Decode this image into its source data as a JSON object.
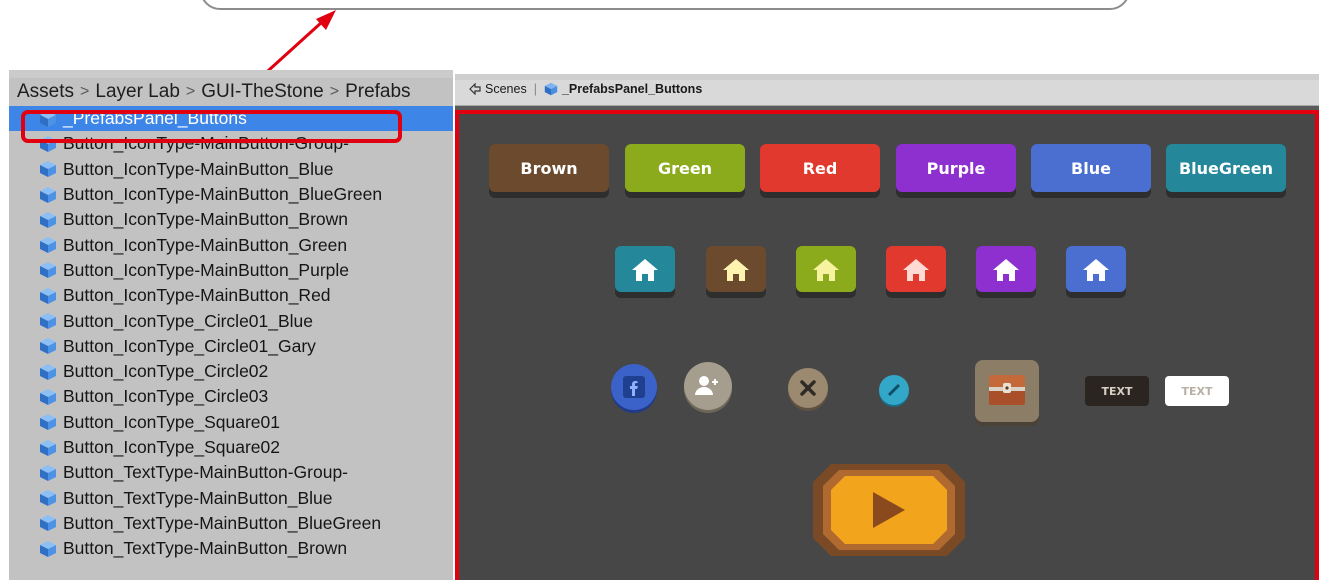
{
  "project_panel": {
    "breadcrumb": [
      "Assets",
      "Layer Lab",
      "GUI-TheStone",
      "Prefabs"
    ],
    "items": [
      {
        "label": "_PrefabsPanel_Buttons",
        "selected": true
      },
      {
        "label": "Button_IconType-MainButton-Group-"
      },
      {
        "label": "Button_IconType-MainButton_Blue"
      },
      {
        "label": "Button_IconType-MainButton_BlueGreen"
      },
      {
        "label": "Button_IconType-MainButton_Brown"
      },
      {
        "label": "Button_IconType-MainButton_Green"
      },
      {
        "label": "Button_IconType-MainButton_Purple"
      },
      {
        "label": "Button_IconType-MainButton_Red"
      },
      {
        "label": "Button_IconType_Circle01_Blue"
      },
      {
        "label": "Button_IconType_Circle01_Gary"
      },
      {
        "label": "Button_IconType_Circle02"
      },
      {
        "label": "Button_IconType_Circle03"
      },
      {
        "label": "Button_IconType_Square01"
      },
      {
        "label": "Button_IconType_Square02"
      },
      {
        "label": "Button_TextType-MainButton-Group-"
      },
      {
        "label": "Button_TextType-MainButton_Blue"
      },
      {
        "label": "Button_TextType-MainButton_BlueGreen"
      },
      {
        "label": "Button_TextType-MainButton_Brown"
      }
    ]
  },
  "scene_header": {
    "scenes_label": "Scenes",
    "prefab_label": "_PrefabsPanel_Buttons"
  },
  "scene": {
    "text_buttons": [
      {
        "label": "Brown",
        "color": "#6b4a2e"
      },
      {
        "label": "Green",
        "color": "#8bab1c"
      },
      {
        "label": "Red",
        "color": "#e2392e"
      },
      {
        "label": "Purple",
        "color": "#8e2fcf"
      },
      {
        "label": "Blue",
        "color": "#4a6fd0"
      },
      {
        "label": "BlueGreen",
        "color": "#24879a"
      }
    ],
    "home_buttons": [
      {
        "color": "#24879a"
      },
      {
        "color": "#6b4a2e"
      },
      {
        "color": "#8bab1c"
      },
      {
        "color": "#e2392e"
      },
      {
        "color": "#8e2fcf"
      },
      {
        "color": "#4a6fd0"
      }
    ],
    "small_text_buttons": [
      {
        "label": "TEXT",
        "style": "dark"
      },
      {
        "label": "TEXT",
        "style": "light"
      }
    ]
  }
}
